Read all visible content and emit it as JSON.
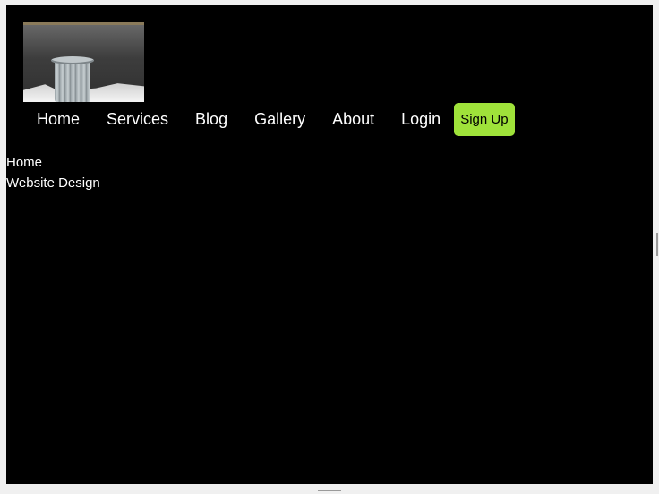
{
  "nav": {
    "items": [
      {
        "label": "Home"
      },
      {
        "label": "Services"
      },
      {
        "label": "Blog"
      },
      {
        "label": "Gallery"
      },
      {
        "label": "About"
      },
      {
        "label": "Login"
      }
    ],
    "signup_label": "Sign Up",
    "signup_color": "#9fe23a"
  },
  "content": {
    "lines": [
      "Home",
      "Website Design"
    ]
  },
  "colors": {
    "page_background": "#000000",
    "text": "#ffffff"
  }
}
